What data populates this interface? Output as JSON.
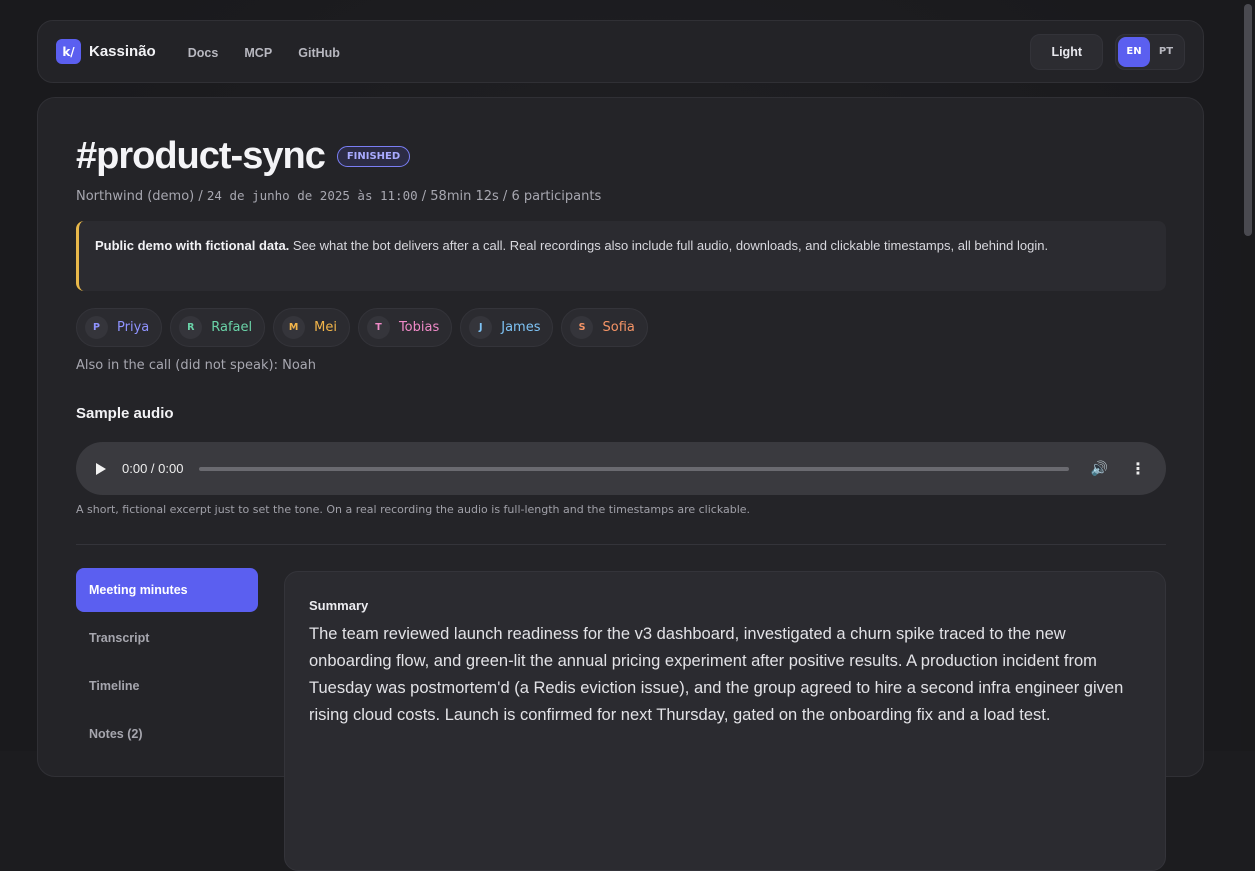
{
  "brand": {
    "logo": "k/",
    "name": "Kassinão"
  },
  "nav": [
    "Docs",
    "MCP",
    "GitHub"
  ],
  "theme_toggle": "Light",
  "languages": [
    {
      "code": "EN",
      "active": true
    },
    {
      "code": "PT",
      "active": false
    }
  ],
  "meeting": {
    "title": "#product-sync",
    "status": "FINISHED",
    "org": "Northwind (demo)",
    "datetime": "24 de junho de 2025 às 11:00",
    "duration": "58min 12s",
    "participants_count": "6 participants"
  },
  "notice": {
    "bold": "Public demo with fictional data.",
    "text": " See what the bot delivers after a call. Real recordings also include full audio, downloads, and clickable timestamps, all behind login."
  },
  "participants": [
    {
      "initial": "P",
      "name": "Priya",
      "color": "#8f93ff"
    },
    {
      "initial": "R",
      "name": "Rafael",
      "color": "#6ad3a8"
    },
    {
      "initial": "M",
      "name": "Mei",
      "color": "#f2b54a"
    },
    {
      "initial": "T",
      "name": "Tobias",
      "color": "#f08ac8"
    },
    {
      "initial": "J",
      "name": "James",
      "color": "#7ec3f5"
    },
    {
      "initial": "S",
      "name": "Sofia",
      "color": "#f59466"
    }
  ],
  "silent_participants": "Also in the call (did not speak): Noah",
  "audio": {
    "section_title": "Sample audio",
    "time": "0:00 / 0:00",
    "hint": "A short, fictional excerpt just to set the tone. On a real recording the audio is full-length and the timestamps are clickable."
  },
  "tabs": [
    {
      "label": "Meeting minutes",
      "active": true
    },
    {
      "label": "Transcript",
      "active": false
    },
    {
      "label": "Timeline",
      "active": false
    },
    {
      "label": "Notes (2)",
      "active": false
    }
  ],
  "summary": {
    "title": "Summary",
    "text": "The team reviewed launch readiness for the v3 dashboard, investigated a churn spike traced to the new onboarding flow, and green-lit the annual pricing experiment after positive results. A production incident from Tuesday was postmortem'd (a Redis eviction issue), and the group agreed to hire a second infra engineer given rising cloud costs. Launch is confirmed for next Thursday, gated on the onboarding fix and a load test."
  }
}
